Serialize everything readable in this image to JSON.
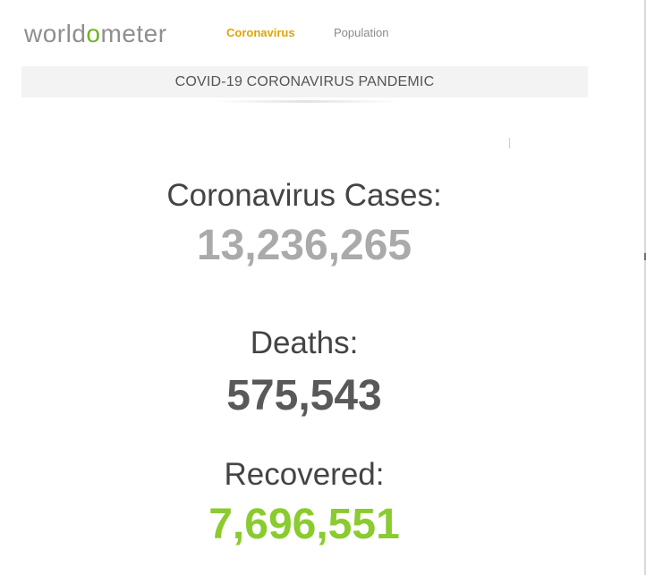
{
  "header": {
    "logo": {
      "part1": "world",
      "accent": "o",
      "part2": "meter"
    },
    "nav": {
      "coronavirus": "Coronavirus",
      "population": "Population"
    }
  },
  "banner": {
    "title": "COVID-19 CORONAVIRUS PANDEMIC"
  },
  "counters": {
    "cases": {
      "label": "Coronavirus Cases:",
      "value": "13,236,265"
    },
    "deaths": {
      "label": "Deaths:",
      "value": "575,543"
    },
    "recovered": {
      "label": "Recovered:",
      "value": "7,696,551"
    }
  },
  "colors": {
    "logo_text": "#8f8f8f",
    "logo_accent": "#6bb51a",
    "nav_active": "#e0a500",
    "nav_inactive": "#8a8a8a",
    "cases_number": "#aaaaaa",
    "deaths_number": "#595959",
    "recovered_number": "#8acb2e"
  }
}
